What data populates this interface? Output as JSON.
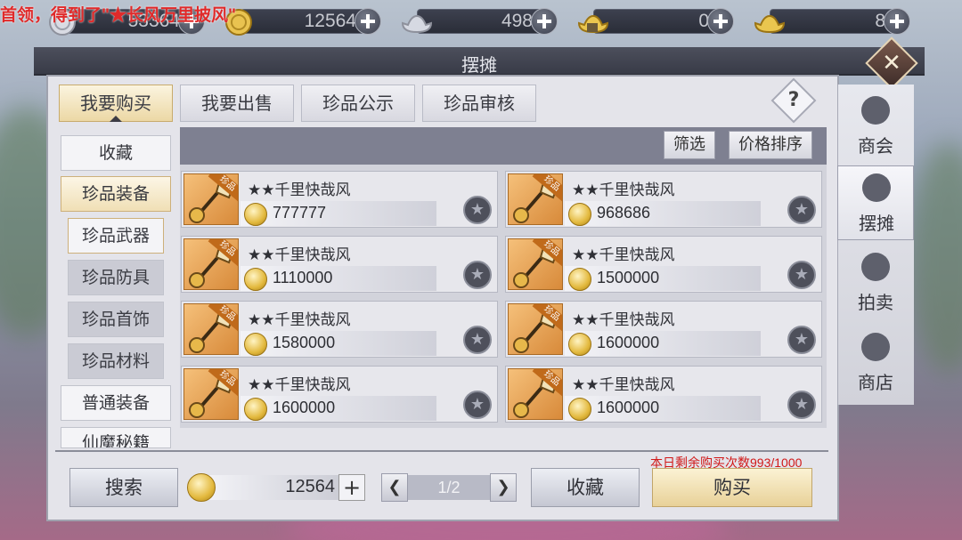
{
  "notice": "首领，得到了\"★长风万里披风\"",
  "currencies": [
    {
      "icon": "silver-coin-icon",
      "value": "53364"
    },
    {
      "icon": "gold-coin-icon",
      "value": "12564"
    },
    {
      "icon": "silver-ingot-icon",
      "value": "498"
    },
    {
      "icon": "locked-gold-ingot-icon",
      "value": "0"
    },
    {
      "icon": "gold-ingot-icon",
      "value": "8"
    }
  ],
  "window": {
    "title": "摆摊",
    "close": "✕"
  },
  "tabs": [
    {
      "label": "我要购买",
      "active": true
    },
    {
      "label": "我要出售",
      "active": false
    },
    {
      "label": "珍品公示",
      "active": false
    },
    {
      "label": "珍品审核",
      "active": false
    }
  ],
  "help": "?",
  "categories": {
    "favorites": "收藏",
    "rare_equipment": "珍品装备",
    "sub": [
      "珍品武器",
      "珍品防具",
      "珍品首饰",
      "珍品材料"
    ],
    "normal_equipment": "普通装备",
    "secret_books": "仙魔秘籍"
  },
  "filter": {
    "filter_label": "筛选",
    "sort_label": "价格排序"
  },
  "item_tag": "珍品",
  "items": [
    {
      "name": "★★千里快哉风",
      "price": "777777"
    },
    {
      "name": "★★千里快哉风",
      "price": "968686"
    },
    {
      "name": "★★千里快哉风",
      "price": "1110000"
    },
    {
      "name": "★★千里快哉风",
      "price": "1500000"
    },
    {
      "name": "★★千里快哉风",
      "price": "1580000"
    },
    {
      "name": "★★千里快哉风",
      "price": "1600000"
    },
    {
      "name": "★★千里快哉风",
      "price": "1600000"
    },
    {
      "name": "★★千里快哉风",
      "price": "1600000"
    }
  ],
  "bottom": {
    "remain_text": "本日剩余购买次数993/1000",
    "search_label": "搜索",
    "gold": "12564",
    "page": "1/2",
    "favorite_label": "收藏",
    "buy_label": "购买"
  },
  "right_nav": [
    {
      "label": "商会",
      "icon": "guild-icon",
      "selected": false
    },
    {
      "label": "摆摊",
      "icon": "stall-bag-icon",
      "selected": true
    },
    {
      "label": "拍卖",
      "icon": "auction-icon",
      "selected": false
    },
    {
      "label": "商店",
      "icon": "shop-icon",
      "selected": false
    }
  ]
}
